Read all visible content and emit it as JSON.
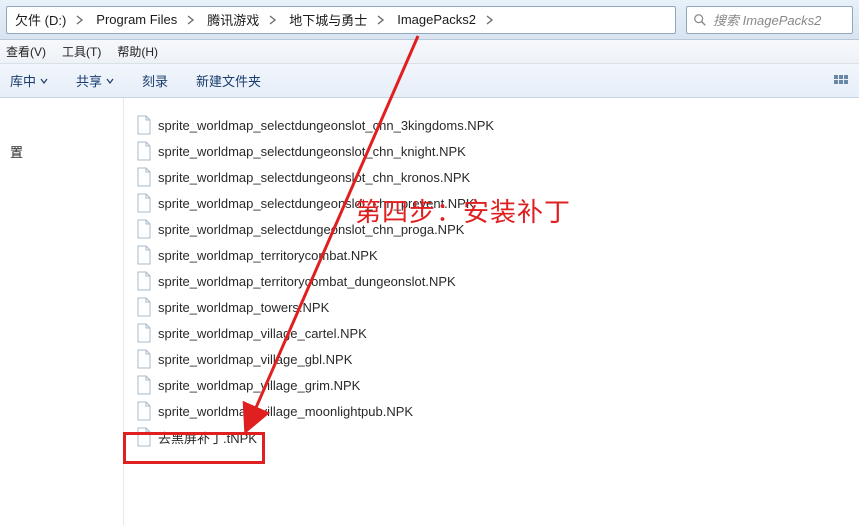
{
  "breadcrumb": {
    "items": [
      {
        "label": "欠件 (D:)"
      },
      {
        "label": "Program Files"
      },
      {
        "label": "腾讯游戏"
      },
      {
        "label": "地下城与勇士"
      },
      {
        "label": "ImagePacks2"
      }
    ]
  },
  "search": {
    "placeholder": "搜索 ImagePacks2"
  },
  "menu": {
    "view": "查看(V)",
    "tools": "工具(T)",
    "help": "帮助(H)"
  },
  "toolbar": {
    "include": "库中",
    "share": "共享",
    "burn": "刻录",
    "newfolder": "新建文件夹"
  },
  "sidebar": {
    "item0": "置"
  },
  "files": {
    "list": [
      {
        "name": "sprite_worldmap_selectdungeonslot_chn_3kingdoms.NPK"
      },
      {
        "name": "sprite_worldmap_selectdungeonslot_chn_knight.NPK"
      },
      {
        "name": "sprite_worldmap_selectdungeonslot_chn_kronos.NPK"
      },
      {
        "name": "sprite_worldmap_selectdungeonslot_chn_prevent.NPK"
      },
      {
        "name": "sprite_worldmap_selectdungeonslot_chn_proga.NPK"
      },
      {
        "name": "sprite_worldmap_territorycombat.NPK"
      },
      {
        "name": "sprite_worldmap_territorycombat_dungeonslot.NPK"
      },
      {
        "name": "sprite_worldmap_towers.NPK"
      },
      {
        "name": "sprite_worldmap_village_cartel.NPK"
      },
      {
        "name": "sprite_worldmap_village_gbl.NPK"
      },
      {
        "name": "sprite_worldmap_village_grim.NPK"
      },
      {
        "name": "sprite_worldmap_village_moonlightpub.NPK"
      },
      {
        "name": "去黑屏补丁.tNPK"
      }
    ]
  },
  "annotation": {
    "text": "第四步：安装补丁"
  }
}
